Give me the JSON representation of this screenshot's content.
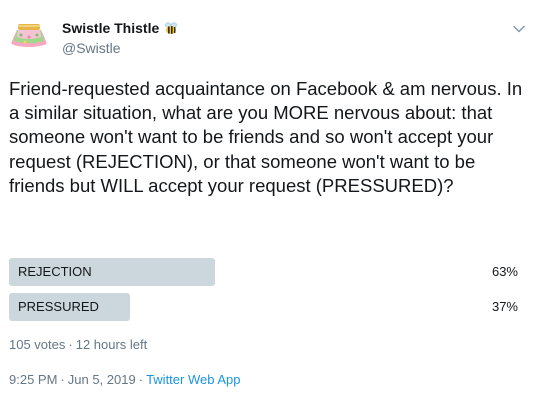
{
  "author": {
    "display_name": "Swistle Thistle",
    "handle": "@Swistle",
    "avatar_icon": "tutu-skirt-avatar",
    "badge_icon": "bee-emoji-icon"
  },
  "tweet": {
    "text": "Friend-requested acquaintance on Facebook & am nervous. In a similar situation, what are you MORE nervous about: that someone won't want to be friends and so won't accept your request (REJECTION), or that someone won't want to be friends but WILL accept your request (PRESSURED)?"
  },
  "poll": {
    "options": [
      {
        "label": "REJECTION",
        "percent_label": "63%",
        "percent": 63
      },
      {
        "label": "PRESSURED",
        "percent_label": "37%",
        "percent": 37
      }
    ],
    "votes": "105 votes",
    "time_left": "12 hours left"
  },
  "footer": {
    "time": "9:25 PM",
    "date": "Jun 5, 2019",
    "source": "Twitter Web App"
  },
  "colors": {
    "bar": "#ccd6dd",
    "link": "#1b95e0",
    "muted": "#657786",
    "text": "#14171a"
  },
  "meta_separator": "·"
}
